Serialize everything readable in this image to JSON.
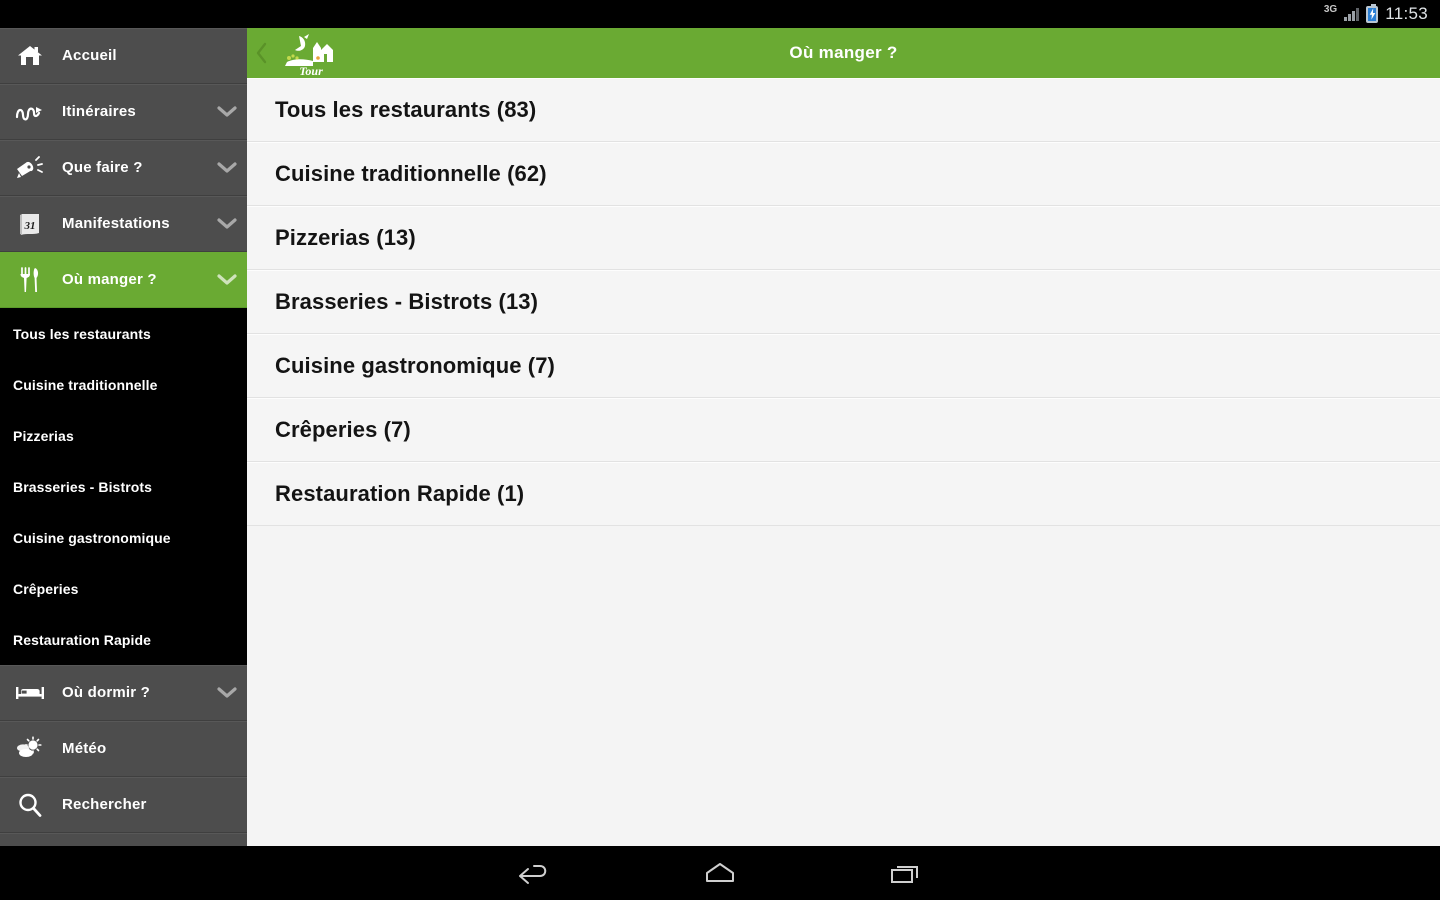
{
  "statusbar": {
    "network": "3G",
    "time": "11:53",
    "battery_icon": "battery-charging-icon",
    "signal_icon": "signal-bars-icon"
  },
  "header": {
    "title": "Où manger ?",
    "back_icon": "chevron-left-icon",
    "logo_label": "Tour",
    "accent_color": "#6aaa33"
  },
  "sidebar": {
    "items": [
      {
        "label": "Accueil",
        "icon": "home-icon",
        "chevron": false,
        "active": false
      },
      {
        "label": "Itinéraires",
        "icon": "route-icon",
        "chevron": true,
        "active": false
      },
      {
        "label": "Que faire ?",
        "icon": "megaphone-icon",
        "chevron": true,
        "active": false
      },
      {
        "label": "Manifestations",
        "icon": "calendar-31-icon",
        "chevron": true,
        "active": false
      },
      {
        "label": "Où manger ?",
        "icon": "cutlery-icon",
        "chevron": true,
        "active": true
      }
    ],
    "submenu": [
      {
        "label": "Tous les restaurants"
      },
      {
        "label": "Cuisine traditionnelle"
      },
      {
        "label": "Pizzerias"
      },
      {
        "label": "Brasseries - Bistrots"
      },
      {
        "label": "Cuisine gastronomique"
      },
      {
        "label": "Crêperies"
      },
      {
        "label": "Restauration Rapide"
      }
    ],
    "items_after": [
      {
        "label": "Où dormir ?",
        "icon": "bed-icon",
        "chevron": true,
        "active": false
      },
      {
        "label": "Météo",
        "icon": "weather-sun-cloud-icon",
        "chevron": false,
        "active": false
      },
      {
        "label": "Rechercher",
        "icon": "search-icon",
        "chevron": false,
        "active": false
      }
    ]
  },
  "list": {
    "rows": [
      {
        "label": "Tous les restaurants (83)"
      },
      {
        "label": "Cuisine traditionnelle (62)"
      },
      {
        "label": "Pizzerias (13)"
      },
      {
        "label": "Brasseries - Bistrots (13)"
      },
      {
        "label": "Cuisine gastronomique (7)"
      },
      {
        "label": "Crêperies (7)"
      },
      {
        "label": "Restauration Rapide (1)"
      }
    ]
  },
  "navbar": {
    "back_icon": "android-back-icon",
    "home_icon": "android-home-icon",
    "recents_icon": "android-recents-icon"
  }
}
